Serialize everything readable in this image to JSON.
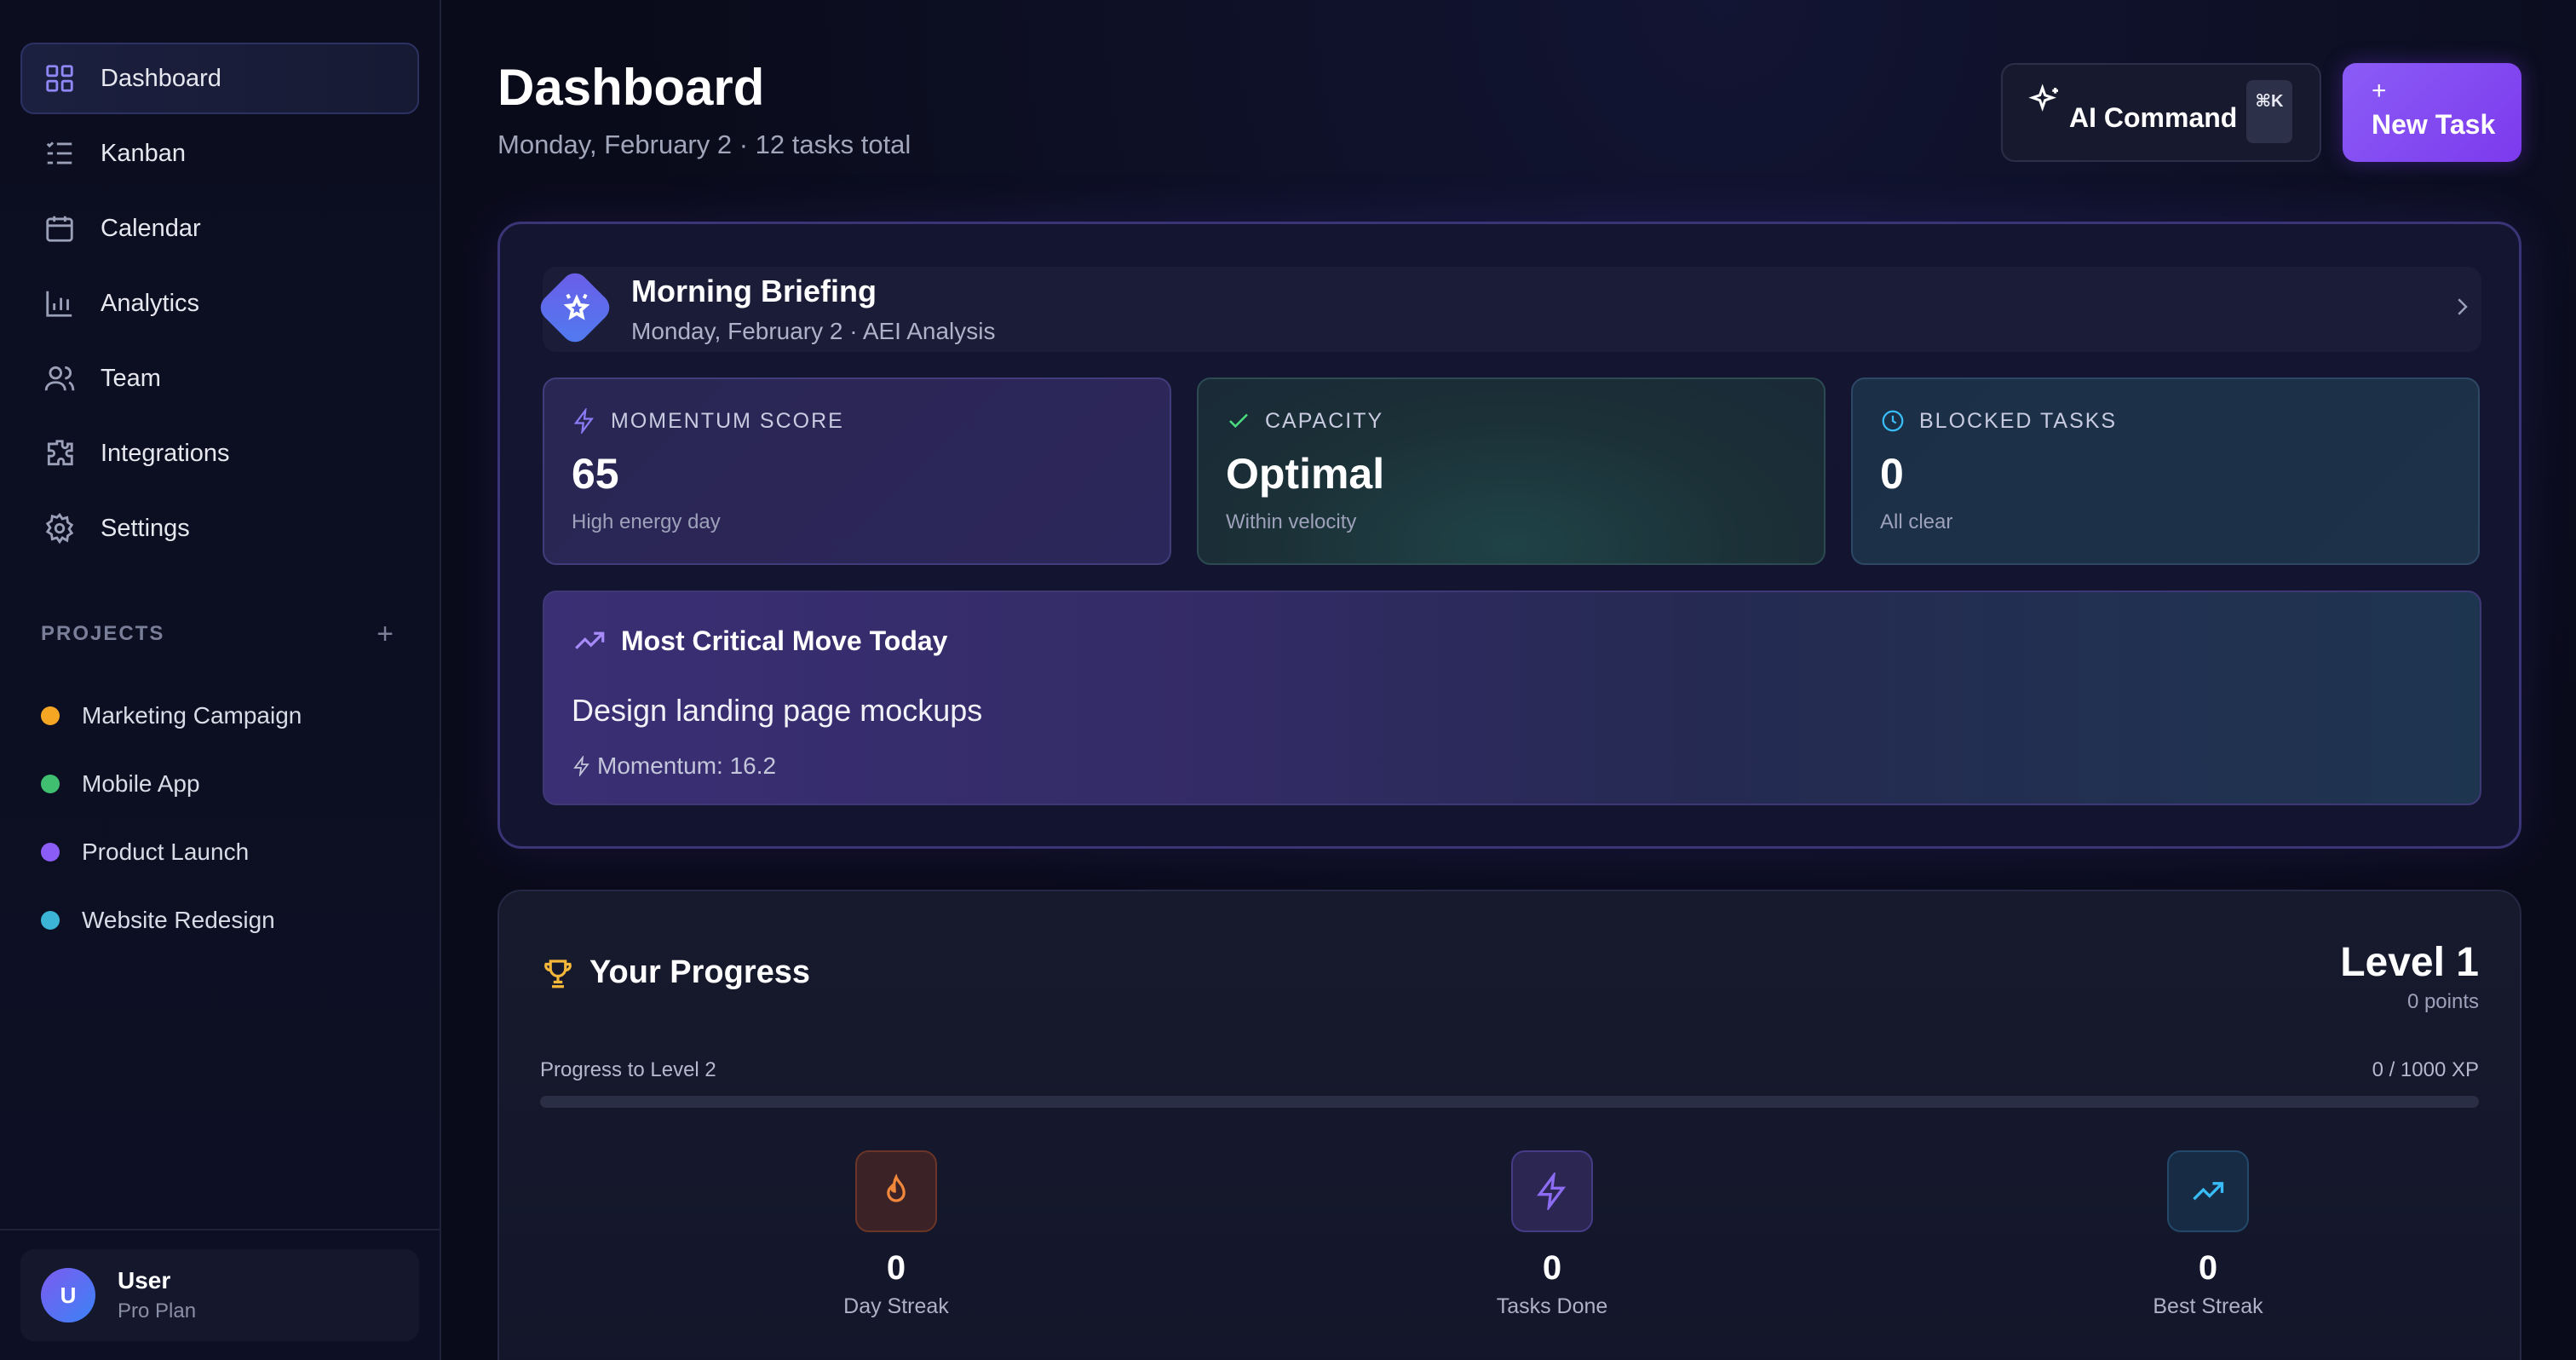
{
  "sidebar": {
    "nav": [
      {
        "label": "Dashboard",
        "icon": "grid-icon",
        "active": true
      },
      {
        "label": "Kanban",
        "icon": "list-check-icon"
      },
      {
        "label": "Calendar",
        "icon": "calendar-icon"
      },
      {
        "label": "Analytics",
        "icon": "bar-chart-icon"
      },
      {
        "label": "Team",
        "icon": "users-icon"
      },
      {
        "label": "Integrations",
        "icon": "puzzle-icon"
      },
      {
        "label": "Settings",
        "icon": "gear-icon"
      }
    ],
    "projects_label": "PROJECTS",
    "projects_add": "+",
    "projects": [
      {
        "label": "Marketing Campaign",
        "color": "#f5a623"
      },
      {
        "label": "Mobile App",
        "color": "#3fbf6f"
      },
      {
        "label": "Product Launch",
        "color": "#8b5cf6"
      },
      {
        "label": "Website Redesign",
        "color": "#3bb4d6"
      }
    ],
    "user": {
      "initial": "U",
      "name": "User",
      "plan": "Pro Plan"
    }
  },
  "header": {
    "title": "Dashboard",
    "subtitle": "Monday, February 2 · 12 tasks total",
    "ai_button": "AI Command",
    "ai_shortcut": "⌘K",
    "new_task_plus": "+",
    "new_task_label": "New Task"
  },
  "briefing": {
    "title": "Morning Briefing",
    "subtitle": "Monday, February 2 · AEI Analysis",
    "stats": [
      {
        "label": "MOMENTUM SCORE",
        "value": "65",
        "note": "High energy day",
        "icon": "bolt-icon"
      },
      {
        "label": "CAPACITY",
        "value": "Optimal",
        "note": "Within velocity",
        "icon": "check-icon"
      },
      {
        "label": "BLOCKED TASKS",
        "value": "0",
        "note": "All clear",
        "icon": "clock-icon"
      }
    ],
    "critical": {
      "title": "Most Critical Move Today",
      "task": "Design landing page mockups",
      "momentum": "Momentum: 16.2"
    }
  },
  "progress": {
    "title": "Your Progress",
    "level": "Level 1",
    "points": "0 points",
    "to_next": "Progress to Level 2",
    "xp": "0 / 1000 XP",
    "fraction": 0,
    "kpis": [
      {
        "value": "0",
        "label": "Day Streak",
        "icon": "flame-icon",
        "color": "#f0873a"
      },
      {
        "value": "0",
        "label": "Tasks Done",
        "icon": "bolt-icon",
        "color": "#8b6cf2"
      },
      {
        "value": "0",
        "label": "Best Streak",
        "icon": "trending-up-icon",
        "color": "#38bdf8"
      }
    ]
  }
}
